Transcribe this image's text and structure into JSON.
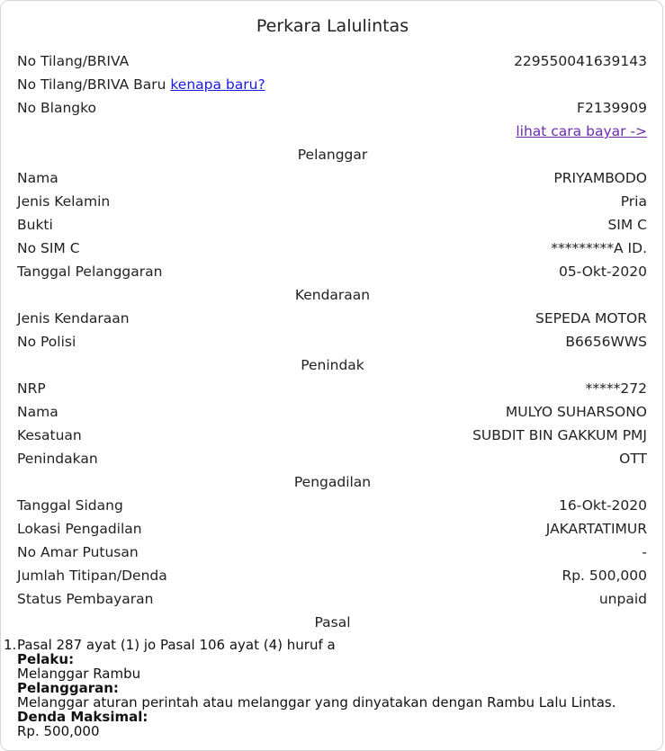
{
  "title": "Perkara Lalulintas",
  "tilang": {
    "no_label": "No Tilang/BRIVA",
    "no_value": "229550041639143",
    "baru_label": "No Tilang/BRIVA Baru",
    "baru_link": "kenapa baru?",
    "blangko_label": "No Blangko",
    "blangko_value": "F2139909",
    "cara_bayar_link": "lihat cara bayar ->"
  },
  "pelanggar": {
    "heading": "Pelanggar",
    "nama_label": "Nama",
    "nama_value": "PRIYAMBODO",
    "jk_label": "Jenis Kelamin",
    "jk_value": "Pria",
    "bukti_label": "Bukti",
    "bukti_value": "SIM C",
    "sim_label": "No SIM C",
    "sim_value": "*********A ID.",
    "tgl_label": "Tanggal Pelanggaran",
    "tgl_value": "05-Okt-2020"
  },
  "kendaraan": {
    "heading": "Kendaraan",
    "jenis_label": "Jenis Kendaraan",
    "jenis_value": "SEPEDA MOTOR",
    "polisi_label": "No Polisi",
    "polisi_value": "B6656WWS"
  },
  "penindak": {
    "heading": "Penindak",
    "nrp_label": "NRP",
    "nrp_value": "*****272",
    "nama_label": "Nama",
    "nama_value": "MULYO SUHARSONO",
    "kesatuan_label": "Kesatuan",
    "kesatuan_value": "SUBDIT BIN GAKKUM PMJ",
    "penindakan_label": "Penindakan",
    "penindakan_value": "OTT"
  },
  "pengadilan": {
    "heading": "Pengadilan",
    "sidang_label": "Tanggal Sidang",
    "sidang_value": "16-Okt-2020",
    "lokasi_label": "Lokasi Pengadilan",
    "lokasi_value": "JAKARTATIMUR",
    "amar_label": "No Amar Putusan",
    "amar_value": "-",
    "denda_label": "Jumlah Titipan/Denda",
    "denda_value": "Rp. 500,000",
    "status_label": "Status Pembayaran",
    "status_value": "unpaid"
  },
  "pasal": {
    "heading": "Pasal",
    "item_number": "1.",
    "item_title": "Pasal 287 ayat (1) jo Pasal 106 ayat (4) huruf a",
    "pelaku_label": "Pelaku:",
    "pelaku_value": "Melanggar Rambu",
    "pelanggaran_label": "Pelanggaran:",
    "pelanggaran_value": "Melanggar aturan perintah atau melanggar yang dinyatakan dengan Rambu Lalu Lintas.",
    "denda_label": "Denda Maksimal:",
    "denda_value": "Rp. 500,000"
  }
}
